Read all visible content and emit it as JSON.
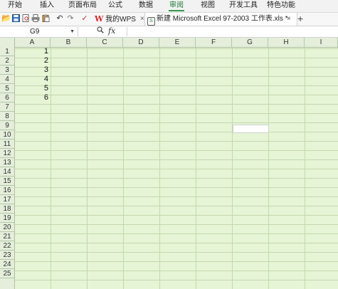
{
  "menu": {
    "items": [
      "开始",
      "插入",
      "页面布局",
      "公式",
      "数据",
      "审阅",
      "视图",
      "开发工具",
      "特色功能"
    ],
    "active_index": 5
  },
  "toolbar": {
    "icons": [
      "open-icon",
      "save-icon",
      "print-preview-icon",
      "print-icon",
      "paste-icon",
      "undo-icon",
      "redo-icon",
      "format-painter-icon"
    ]
  },
  "tabs": {
    "wps_label": "我的WPS",
    "excel_label": "新建 Microsoft Excel 97-2003 工作表.xls *",
    "close_glyph": "×",
    "add_glyph": "+"
  },
  "formula_bar": {
    "name_box": "G9",
    "fx_label": "fx",
    "formula_value": ""
  },
  "sheet": {
    "columns": [
      "A",
      "B",
      "C",
      "D",
      "E",
      "F",
      "G",
      "H",
      "I"
    ],
    "rows": [
      "1",
      "2",
      "3",
      "4",
      "5",
      "6",
      "7",
      "8",
      "9",
      "10",
      "11",
      "12",
      "13",
      "14",
      "15",
      "16",
      "17",
      "18",
      "19",
      "20",
      "21",
      "22",
      "23",
      "24",
      "25"
    ],
    "column_a_values": [
      "1",
      "2",
      "3",
      "4",
      "5",
      "6"
    ],
    "selected_cell": "G9"
  },
  "colors": {
    "grid_background": "#e6f5d5",
    "active_menu": "#1e7a35"
  }
}
